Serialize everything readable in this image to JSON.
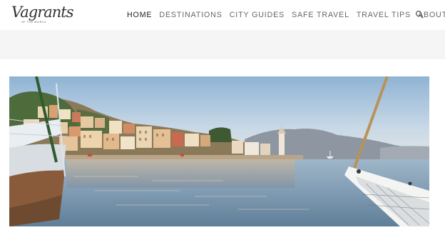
{
  "brand": {
    "logo_text": "Vagrants",
    "logo_tagline": "OF THE WORLD"
  },
  "nav": {
    "items": [
      "HOME",
      "DESTINATIONS",
      "CITY GUIDES",
      "SAFE TRAVEL",
      "TRAVEL TIPS",
      "ABOUT"
    ],
    "active": "HOME"
  },
  "icons": {
    "search": "search-icon"
  },
  "colors": {
    "nav_active": "#222222",
    "nav_text": "#666666",
    "band": "#f5f5f5"
  }
}
